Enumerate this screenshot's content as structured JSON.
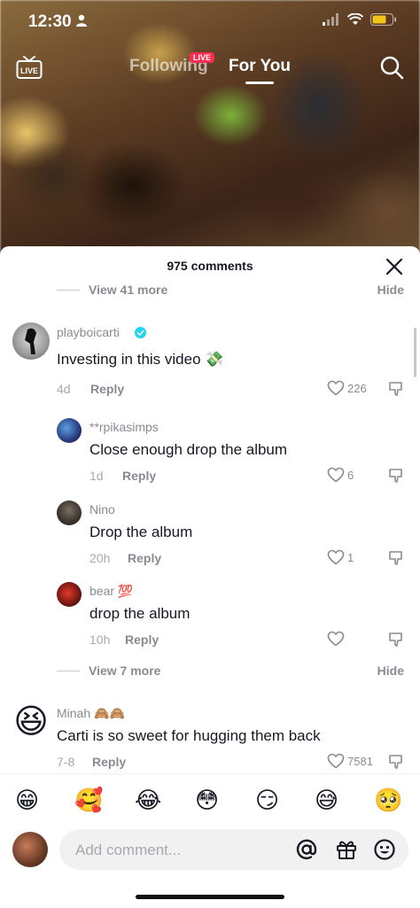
{
  "status": {
    "time": "12:30"
  },
  "nav": {
    "following": "Following",
    "live_badge": "LIVE",
    "for_you": "For You",
    "live_icon_label": "LIVE"
  },
  "sheet": {
    "title": "975 comments"
  },
  "view_more_top": {
    "label": "View 41 more",
    "hide": "Hide"
  },
  "view_more_bottom": {
    "label": "View 7 more",
    "hide": "Hide"
  },
  "comments": [
    {
      "username": "playboicarti",
      "verified": true,
      "text": "Investing in this video 💸",
      "age": "4d",
      "reply": "Reply",
      "likes": "226"
    },
    {
      "username": "**rpikasimps",
      "text": "Close enough drop the album",
      "age": "1d",
      "reply": "Reply",
      "likes": "6"
    },
    {
      "username": "Nino",
      "text": "Drop the album",
      "age": "20h",
      "reply": "Reply",
      "likes": "1"
    },
    {
      "username": "bear 💯",
      "text": "drop the album",
      "age": "10h",
      "reply": "Reply",
      "likes": ""
    },
    {
      "username": "Minah 🙈🙈",
      "text": "Carti is so sweet for hugging them back",
      "age": "7-8",
      "reply": "Reply",
      "likes": "7581"
    }
  ],
  "emojis": [
    "😁",
    "🥰",
    "😂",
    "😳",
    "😏",
    "😅",
    "🥺"
  ],
  "composer": {
    "placeholder": "Add comment..."
  },
  "icons": [
    "live-icon",
    "search-icon",
    "close-icon",
    "verified-icon",
    "heart-icon",
    "dislike-icon",
    "at-icon",
    "gift-icon",
    "smile-icon"
  ]
}
